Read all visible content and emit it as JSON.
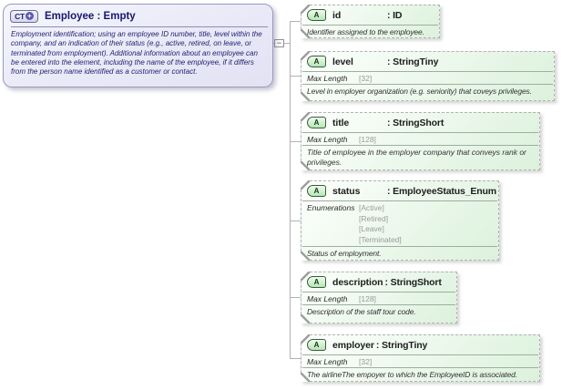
{
  "complex_type": {
    "icon_text": "CT",
    "icon_plus": "+",
    "title": "Employee : Empty",
    "description": "Employment identification; using an employee ID number, title, level within the company, and an indication of their status (e.g., active, retired, on leave, or terminated from employment).  Additional information about an employee can be entered into the element, including the name of the employee, if it differs from the person name identified as a customer or contact."
  },
  "connector": {
    "toggle_label": "−"
  },
  "attributes": [
    {
      "icon": "A",
      "name": "id",
      "type": ": ID",
      "description": "Identifier assigned to the employee."
    },
    {
      "icon": "A",
      "name": "level",
      "type": ": StringTiny",
      "facet_label": "Max Length",
      "facet_value": "[32]",
      "description": "Level in employer organization (e.g. seniority) that coveys privileges."
    },
    {
      "icon": "A",
      "name": "title",
      "type": ": StringShort",
      "facet_label": "Max Length",
      "facet_value": "[128]",
      "description": "Title of employee in the employer company that conveys rank or privileges."
    },
    {
      "icon": "A",
      "name": "status",
      "type": ": EmployeeStatus_Enum",
      "facet_label": "Enumerations",
      "enumerations": [
        "[Active]",
        "[Retired]",
        "[Leave]",
        "[Terminated]"
      ],
      "description": "Status of employment."
    },
    {
      "icon": "A",
      "name": "description",
      "type": ": StringShort",
      "facet_label": "Max Length",
      "facet_value": "[128]",
      "description": "Description of the staff tour code."
    },
    {
      "icon": "A",
      "name": "employer",
      "type": ": StringTiny",
      "facet_label": "Max Length",
      "facet_value": "[32]",
      "description": "The airlineThe empoyer to which the EmployeeID is associated."
    }
  ],
  "colors": {
    "ct_fill": "#e9e9f7",
    "ct_border": "#9a9ac2",
    "ct_text": "#17176b",
    "attr_fill": "#eef9ee",
    "attr_border": "#b2b2b2",
    "icon_green": "#b7e6b7",
    "facet_value_gray": "#9a9a9a",
    "line_gray": "#b2b2b2"
  }
}
